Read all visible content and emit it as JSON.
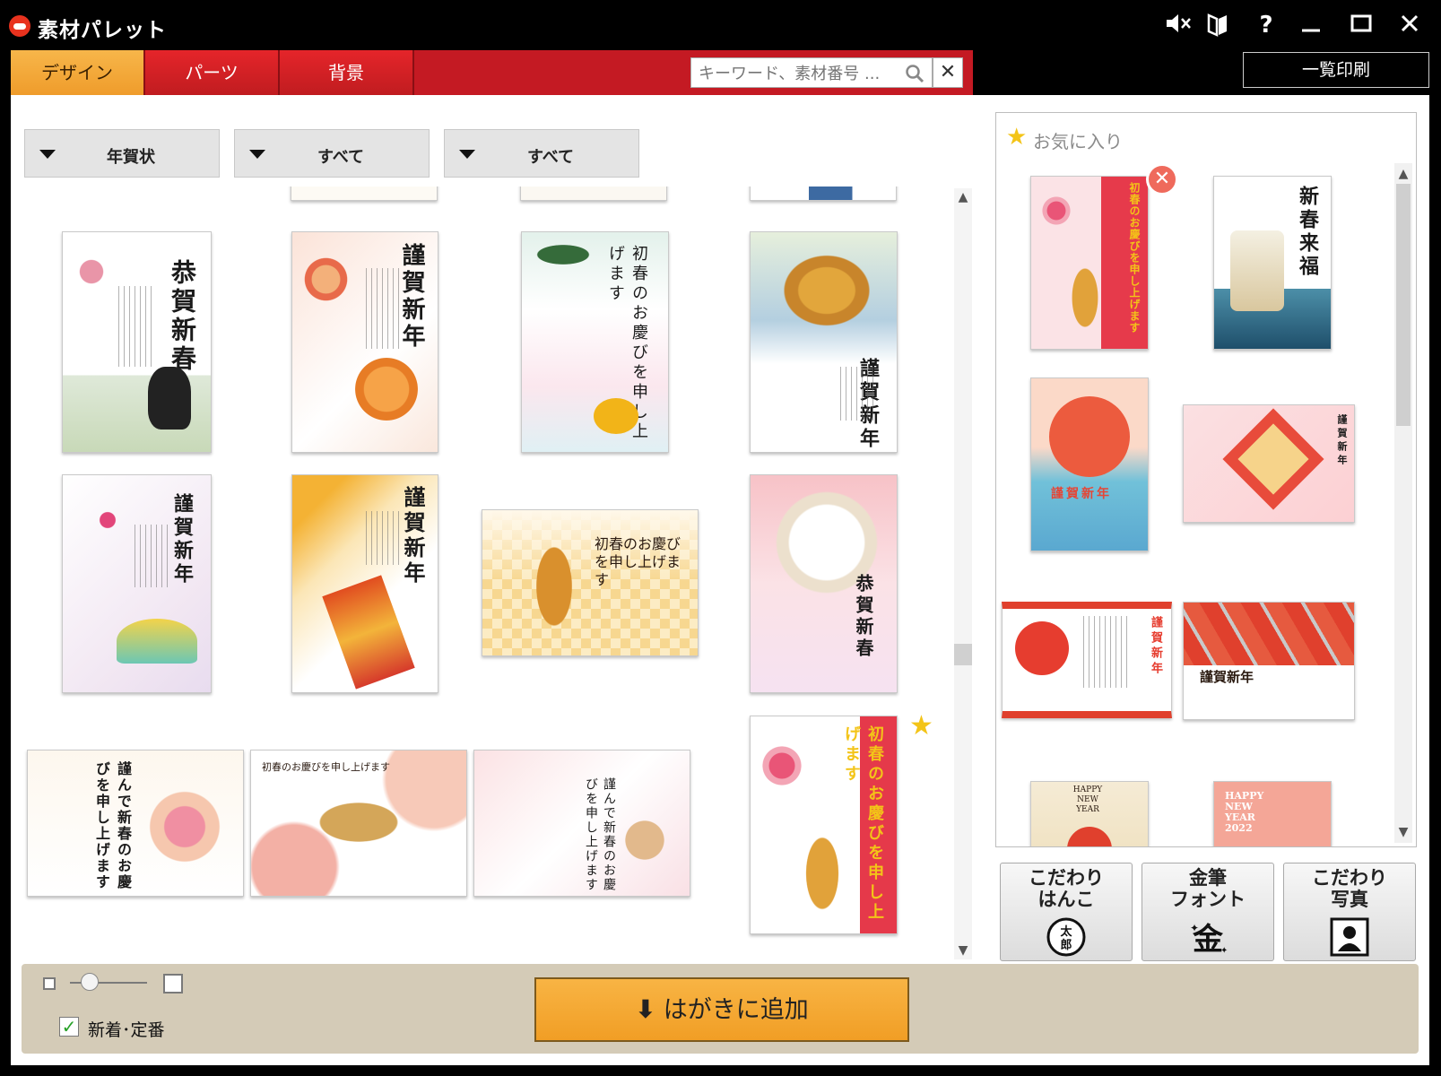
{
  "window": {
    "title": "素材パレット",
    "controls": [
      "mute-icon",
      "book-icon",
      "help-icon",
      "minimize-icon",
      "maximize-icon",
      "close-icon"
    ]
  },
  "tabs": [
    {
      "label": "デザイン",
      "active": true
    },
    {
      "label": "パーツ",
      "active": false
    },
    {
      "label": "背景",
      "active": false
    }
  ],
  "search": {
    "placeholder": "キーワード、素材番号 ...",
    "value": ""
  },
  "toolbar": {
    "print_list_label": "一覧印刷"
  },
  "filters": [
    {
      "label": "年賀状"
    },
    {
      "label": "すべて"
    },
    {
      "label": "すべて"
    }
  ],
  "gallery": {
    "cards": [
      {
        "text": "恭賀新春"
      },
      {
        "text": "謹賀新年"
      },
      {
        "text": "初春のお慶びを申し上げます"
      },
      {
        "text": "謹賀新年"
      },
      {
        "text": "謹賀新年"
      },
      {
        "text": "謹賀新年"
      },
      {
        "text": "初春のお慶びを申し上げます"
      },
      {
        "text": "恭賀新春"
      },
      {
        "text": "謹んで新春のお慶びを申し上げます"
      },
      {
        "text": "初春のお慶びを申し上げます"
      },
      {
        "text": "謹んで新春のお慶びを申し上げます"
      },
      {
        "text": "初春のお慶びを申し上げます"
      }
    ]
  },
  "favorites": {
    "title": "お気に入り",
    "cards": [
      {
        "text": "初春のお慶びを申し上げます"
      },
      {
        "text": "新春来福"
      },
      {
        "text": "謹賀新年"
      },
      {
        "text": "謹賀新年"
      },
      {
        "text": "謹賀新年"
      },
      {
        "text": "謹賀新年"
      },
      {
        "text": "HAPPY NEW YEAR"
      },
      {
        "text": "HAPPY NEW YEAR 2022"
      }
    ]
  },
  "features": [
    {
      "label": "こだわり\nはんこ",
      "icon": "seal-icon",
      "glyph": "太郎"
    },
    {
      "label": "金筆\nフォント",
      "icon": "gold-brush-icon",
      "glyph": "金"
    },
    {
      "label": "こだわり\n写真",
      "icon": "photo-icon",
      "glyph": ""
    }
  ],
  "bottom": {
    "new_label": "新着･定番",
    "new_checked": true,
    "add_button_label": "はがきに追加",
    "thumbnail_size_level": 0.25
  },
  "colors": {
    "tab_active": "#f3a83a",
    "tab_inactive": "#d81f26",
    "add_button": "#f4a833",
    "star": "#f3c418"
  }
}
